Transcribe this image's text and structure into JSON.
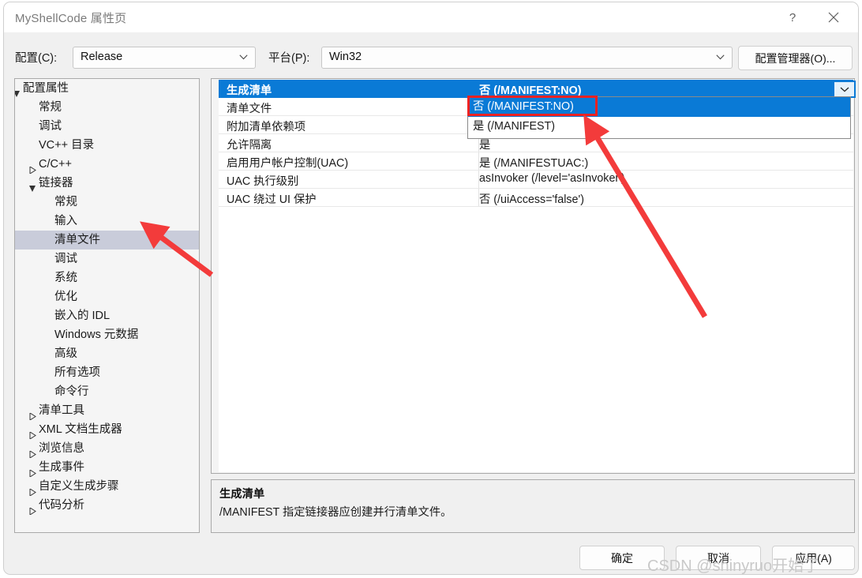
{
  "window": {
    "title": "MyShellCode 属性页",
    "help_icon": "?",
    "close_icon": "close-icon"
  },
  "config_bar": {
    "config_label": "配置(C):",
    "config_value": "Release",
    "platform_label": "平台(P):",
    "platform_value": "Win32",
    "config_manager_button": "配置管理器(O)..."
  },
  "tree": {
    "items": [
      {
        "label": "配置属性",
        "indent": 0,
        "marker": "expanded",
        "selected": false
      },
      {
        "label": "常规",
        "indent": 1,
        "marker": "none",
        "selected": false
      },
      {
        "label": "调试",
        "indent": 1,
        "marker": "none",
        "selected": false
      },
      {
        "label": "VC++ 目录",
        "indent": 1,
        "marker": "none",
        "selected": false
      },
      {
        "label": "C/C++",
        "indent": 1,
        "marker": "collapsed",
        "selected": false
      },
      {
        "label": "链接器",
        "indent": 1,
        "marker": "expanded",
        "selected": false
      },
      {
        "label": "常规",
        "indent": 2,
        "marker": "none",
        "selected": false
      },
      {
        "label": "输入",
        "indent": 2,
        "marker": "none",
        "selected": false
      },
      {
        "label": "清单文件",
        "indent": 2,
        "marker": "none",
        "selected": true
      },
      {
        "label": "调试",
        "indent": 2,
        "marker": "none",
        "selected": false
      },
      {
        "label": "系统",
        "indent": 2,
        "marker": "none",
        "selected": false
      },
      {
        "label": "优化",
        "indent": 2,
        "marker": "none",
        "selected": false
      },
      {
        "label": "嵌入的 IDL",
        "indent": 2,
        "marker": "none",
        "selected": false
      },
      {
        "label": "Windows 元数据",
        "indent": 2,
        "marker": "none",
        "selected": false
      },
      {
        "label": "高级",
        "indent": 2,
        "marker": "none",
        "selected": false
      },
      {
        "label": "所有选项",
        "indent": 2,
        "marker": "none",
        "selected": false
      },
      {
        "label": "命令行",
        "indent": 2,
        "marker": "none",
        "selected": false
      },
      {
        "label": "清单工具",
        "indent": 1,
        "marker": "collapsed",
        "selected": false
      },
      {
        "label": "XML 文档生成器",
        "indent": 1,
        "marker": "collapsed",
        "selected": false
      },
      {
        "label": "浏览信息",
        "indent": 1,
        "marker": "collapsed",
        "selected": false
      },
      {
        "label": "生成事件",
        "indent": 1,
        "marker": "collapsed",
        "selected": false
      },
      {
        "label": "自定义生成步骤",
        "indent": 1,
        "marker": "collapsed",
        "selected": false
      },
      {
        "label": "代码分析",
        "indent": 1,
        "marker": "collapsed",
        "selected": false
      }
    ]
  },
  "property_grid": {
    "rows": [
      {
        "name": "生成清单",
        "value": "否 (/MANIFEST:NO)",
        "selected": true
      },
      {
        "name": "清单文件",
        "value": "",
        "selected": false
      },
      {
        "name": "附加清单依赖项",
        "value": "",
        "selected": false
      },
      {
        "name": "允许隔离",
        "value": "是",
        "selected": false
      },
      {
        "name": "启用用户帐户控制(UAC)",
        "value": "是 (/MANIFESTUAC:)",
        "selected": false
      },
      {
        "name": "UAC 执行级别",
        "value": "asInvoker (/level='asInvoker')",
        "selected": false
      },
      {
        "name": "UAC 绕过 UI 保护",
        "value": "否 (/uiAccess='false')",
        "selected": false
      }
    ]
  },
  "dropdown": {
    "open": true,
    "options": [
      {
        "label": "否 (/MANIFEST:NO)",
        "highlighted": true
      },
      {
        "label": "是 (/MANIFEST)",
        "highlighted": false
      }
    ],
    "toggle_icon": "chevron-down-icon"
  },
  "description": {
    "title": "生成清单",
    "text": "/MANIFEST 指定链接器应创建并行清单文件。"
  },
  "footer": {
    "ok": "确定",
    "cancel": "取消",
    "apply": "应用(A)"
  },
  "annotations": {
    "watermark": "CSDN @shinyruo开始了",
    "accent_red": "#ee2222",
    "accent_blue": "#0a7ad6"
  }
}
